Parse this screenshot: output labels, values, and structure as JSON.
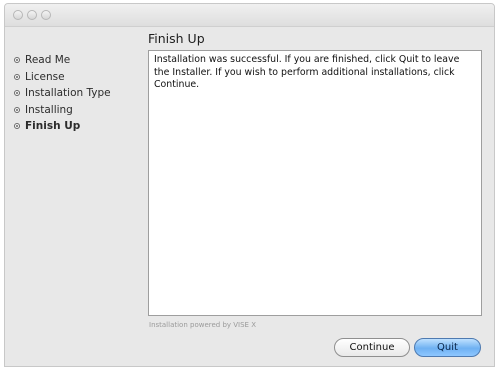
{
  "window": {
    "title": ""
  },
  "sidebar": {
    "items": [
      {
        "label": "Read Me"
      },
      {
        "label": "License"
      },
      {
        "label": "Installation Type"
      },
      {
        "label": "Installing"
      },
      {
        "label": "Finish Up",
        "active": true
      }
    ]
  },
  "main": {
    "title": "Finish Up",
    "message": "Installation was successful. If you are finished, click Quit to leave the Installer. If you wish to perform additional installations, click Continue.",
    "footer": "Installation powered by VISE X"
  },
  "buttons": {
    "continue_label": "Continue",
    "quit_label": "Quit"
  },
  "colors": {
    "accent": "#6fb1f2"
  },
  "icons": {
    "step": "step-bullet-icon"
  }
}
